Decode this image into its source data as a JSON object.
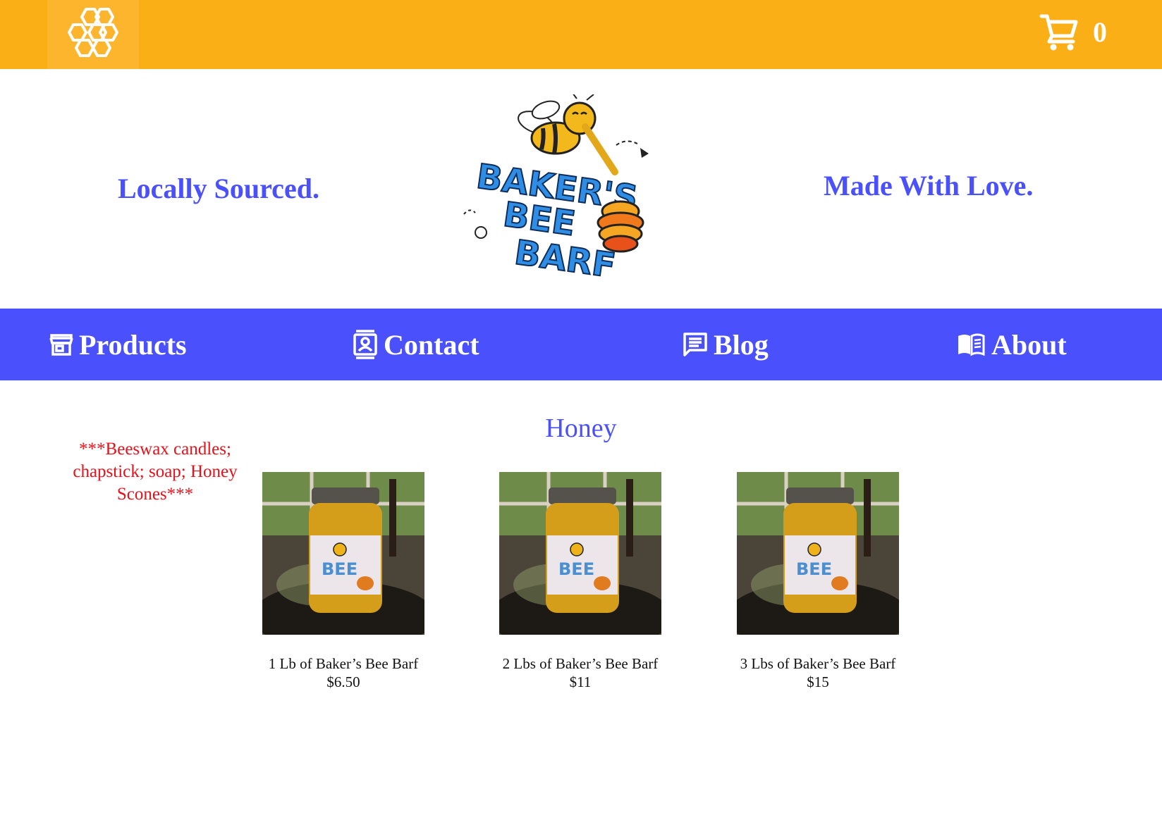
{
  "header": {
    "menu_icon": "honeycomb-icon",
    "cart_icon": "cart-icon",
    "cart_count": "0",
    "bar_color": "#fbaf17"
  },
  "hero": {
    "tagline_left": "Locally Sourced.",
    "tagline_right": "Made With Love.",
    "logo_text": "BAKER'S BEE BARF"
  },
  "nav": {
    "color": "#4a50fb",
    "items": [
      {
        "label": "Products",
        "icon": "storefront-icon"
      },
      {
        "label": "Contact",
        "icon": "contact-card-icon"
      },
      {
        "label": "Blog",
        "icon": "message-icon"
      },
      {
        "label": "About",
        "icon": "open-book-icon"
      }
    ]
  },
  "sidebar": {
    "note": "***Beeswax candles; chapstick; soap; Honey Scones***"
  },
  "main": {
    "section_title": "Honey",
    "products": [
      {
        "name": "1 Lb of Baker’s Bee Barf",
        "price": "$6.50"
      },
      {
        "name": "2 Lbs of Baker’s Bee Barf",
        "price": "$11"
      },
      {
        "name": "3 Lbs of Baker’s Bee Barf",
        "price": "$15"
      }
    ]
  }
}
